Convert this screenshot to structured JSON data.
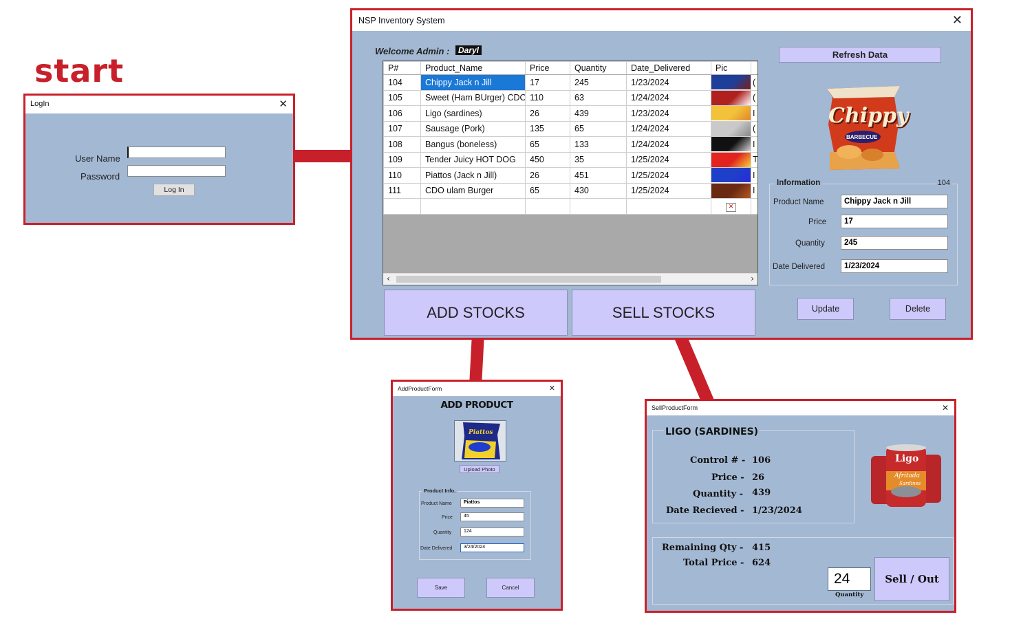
{
  "flow_label": "start",
  "login": {
    "title": "LogIn",
    "username_label": "User Name",
    "password_label": "Password",
    "username_value": "",
    "password_value": "",
    "login_button": "Log In"
  },
  "main": {
    "title": "NSP Inventory System",
    "welcome_text": "Welcome Admin :",
    "admin_name": "Daryl",
    "refresh_button": "Refresh Data",
    "table": {
      "columns": [
        "P#",
        "Product_Name",
        "Price",
        "Quantity",
        "Date_Delivered",
        "Pic"
      ],
      "rows": [
        {
          "id": "104",
          "name": "Chippy Jack n Jill",
          "price": "17",
          "qty": "245",
          "date": "1/23/2024",
          "pic_colors": [
            "#1d3f9a",
            "#7a1e1a"
          ],
          "extra": "("
        },
        {
          "id": "105",
          "name": "Sweet (Ham BUrger) CDO",
          "price": "110",
          "qty": "63",
          "date": "1/24/2024",
          "pic_colors": [
            "#b0201e",
            "#ffffff"
          ],
          "extra": "("
        },
        {
          "id": "106",
          "name": "Ligo (sardines)",
          "price": "26",
          "qty": "439",
          "date": "1/23/2024",
          "pic_colors": [
            "#f2c23a",
            "#e2862a"
          ],
          "extra": "I"
        },
        {
          "id": "107",
          "name": "Sausage (Pork)",
          "price": "135",
          "qty": "65",
          "date": "1/24/2024",
          "pic_colors": [
            "#c9c9c9",
            "#888888"
          ],
          "extra": "("
        },
        {
          "id": "108",
          "name": "Bangus (boneless)",
          "price": "65",
          "qty": "133",
          "date": "1/24/2024",
          "pic_colors": [
            "#111111",
            "#d8d8d8"
          ],
          "extra": "I"
        },
        {
          "id": "109",
          "name": "Tender Juicy HOT DOG",
          "price": "450",
          "qty": "35",
          "date": "1/25/2024",
          "pic_colors": [
            "#e3231d",
            "#f4d23a"
          ],
          "extra": "T"
        },
        {
          "id": "110",
          "name": "Piattos (Jack n Jill)",
          "price": "26",
          "qty": "451",
          "date": "1/25/2024",
          "pic_colors": [
            "#1e3fc8",
            "#2a2ad8"
          ],
          "extra": "I"
        },
        {
          "id": "111",
          "name": "CDO ulam Burger",
          "price": "65",
          "qty": "430",
          "date": "1/25/2024",
          "pic_colors": [
            "#6a2a12",
            "#b45a24"
          ],
          "extra": "I"
        }
      ]
    },
    "add_stocks_button": "ADD STOCKS",
    "sell_stocks_button": "SELL STOCKS",
    "info": {
      "group_title": "Information",
      "id": "104",
      "product_name_label": "Product Name",
      "product_name": "Chippy Jack n Jill",
      "price_label": "Price",
      "price": "17",
      "quantity_label": "Quantity",
      "quantity": "245",
      "date_label": "Date Delivered",
      "date": "1/23/2024"
    },
    "product_image_text": "Chippy",
    "product_image_subtext": "BARBECUE",
    "update_button": "Update",
    "delete_button": "Delete"
  },
  "add_form": {
    "title": "AddProductForm",
    "heading": "ADD PRODUCT",
    "upload_button": "Upload Photo",
    "image_text": "Piattos",
    "group_title": "Product Info.",
    "product_name_label": "Product Name",
    "product_name": "Piattos",
    "price_label": "Price",
    "price": "45",
    "quantity_label": "Quantity",
    "quantity": "124",
    "date_label": "Date Delivered",
    "date": "3/24/2024",
    "save_button": "Save",
    "cancel_button": "Cancel"
  },
  "sell_form": {
    "title": "SellProductForm",
    "product_heading": "LIGO (SARDINES)",
    "control_label": "Control # -",
    "control_value": "106",
    "price_label": "Price -",
    "price_value": "26",
    "quantity_label": "Quantity -",
    "quantity_value": "439",
    "date_label": "Date Recieved -",
    "date_value": "1/23/2024",
    "remaining_label": "Remaining Qty -",
    "remaining_value": "415",
    "total_label": "Total Price -",
    "total_value": "624",
    "sell_qty": "24",
    "qty_caption": "Quantity",
    "sell_button": "Sell / Out",
    "can_text": "Ligo",
    "can_subtext": "Afritada",
    "can_small": "Sardines"
  },
  "colors": {
    "frame_red": "#c8202a",
    "window_bg": "#a3b8d3",
    "button_lavender": "#cdc9fb",
    "selection_blue": "#1a78d6"
  }
}
